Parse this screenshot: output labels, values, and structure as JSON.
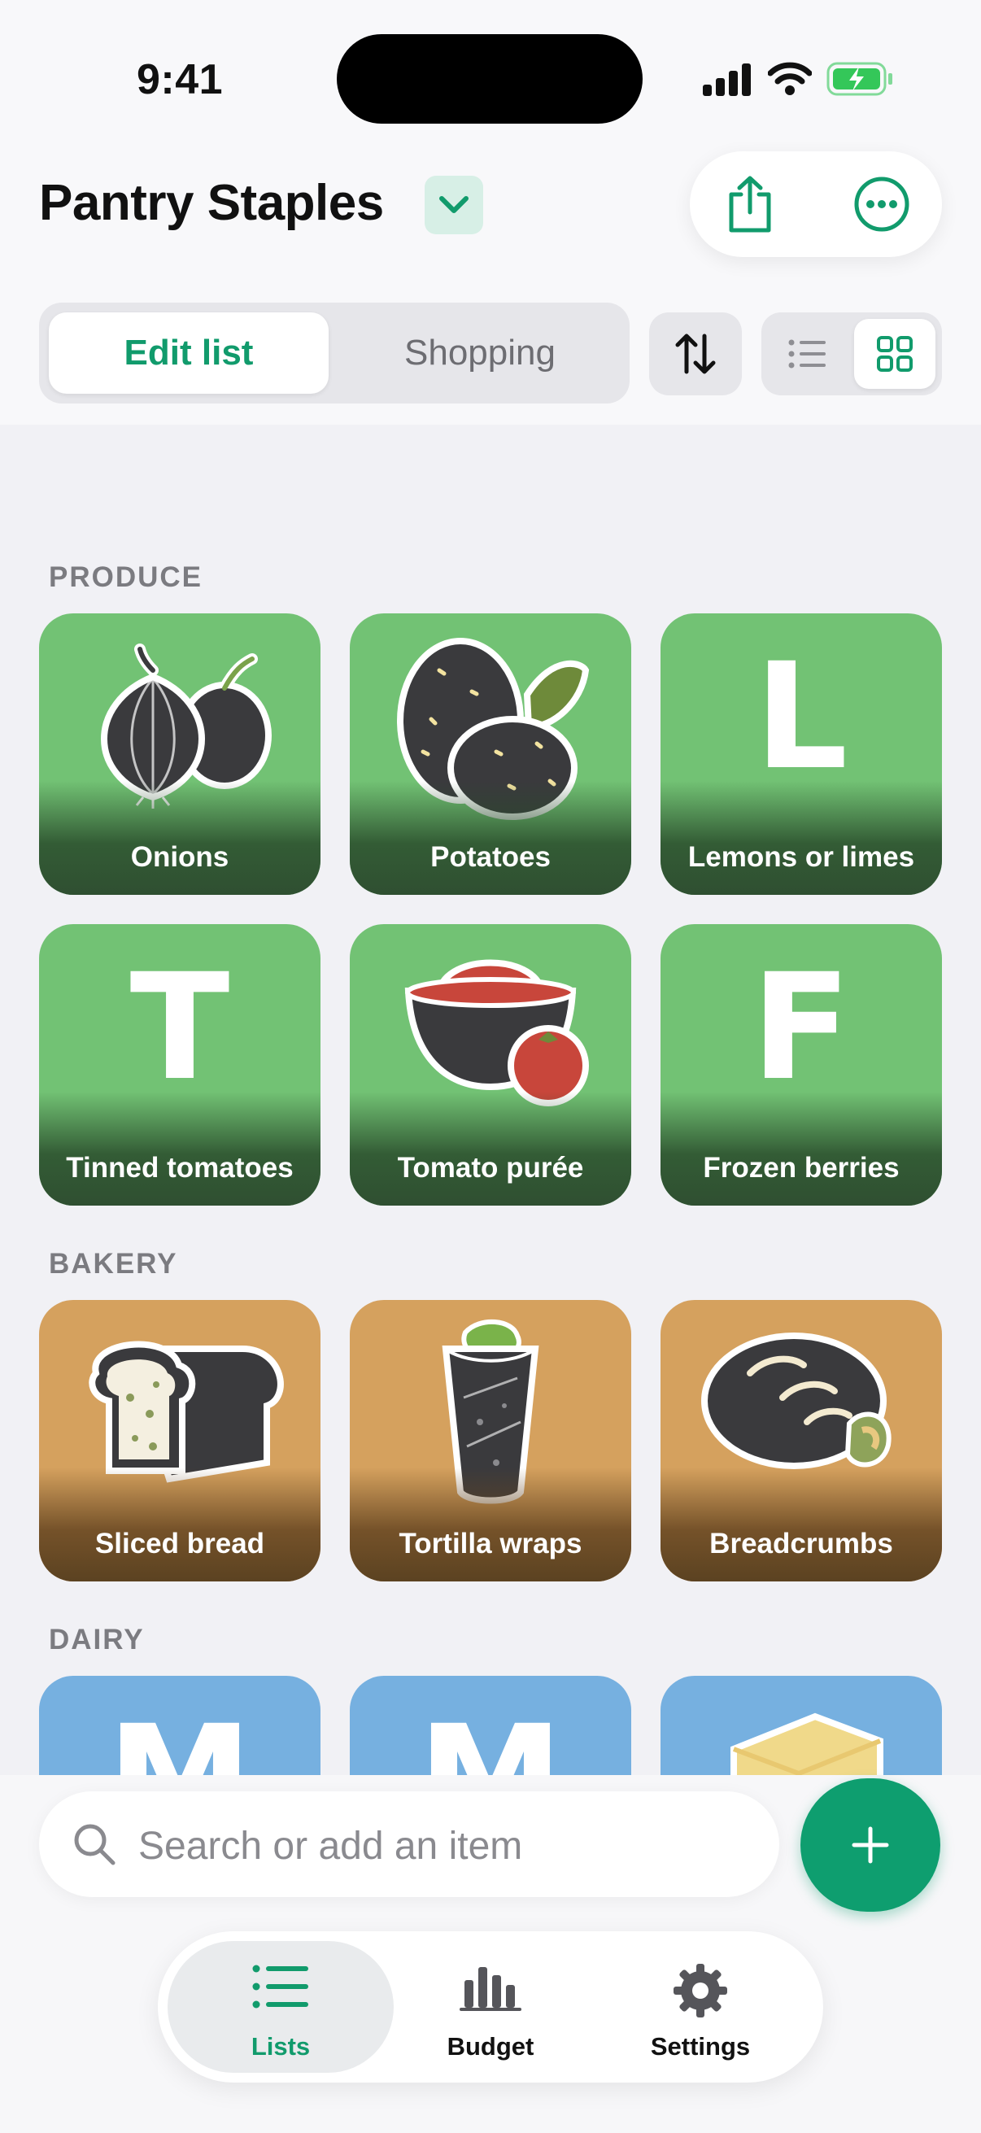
{
  "status_bar": {
    "time": "9:41"
  },
  "header": {
    "title": "Pantry Staples",
    "segments": [
      {
        "label": "Edit list",
        "active": true
      },
      {
        "label": "Shopping",
        "active": false
      }
    ],
    "view_mode": "grid"
  },
  "sections": [
    {
      "label": "PRODUCE",
      "color": "#72c274",
      "items": [
        {
          "label": "Onions",
          "icon": "onion-icon"
        },
        {
          "label": "Potatoes",
          "icon": "potato-icon"
        },
        {
          "label": "Lemons or limes",
          "letter": "L"
        },
        {
          "label": "Tinned tomatoes",
          "letter": "T"
        },
        {
          "label": "Tomato purée",
          "icon": "tomato-puree-icon"
        },
        {
          "label": "Frozen berries",
          "letter": "F"
        }
      ]
    },
    {
      "label": "BAKERY",
      "color": "#d5a15e",
      "items": [
        {
          "label": "Sliced bread",
          "icon": "bread-icon"
        },
        {
          "label": "Tortilla wraps",
          "icon": "wrap-icon"
        },
        {
          "label": "Breadcrumbs",
          "icon": "breadcrumbs-icon"
        }
      ]
    },
    {
      "label": "DAIRY",
      "color": "#76b0e0",
      "items": [
        {
          "letter": "M"
        },
        {
          "letter": "M"
        },
        {
          "icon": "butter-icon"
        }
      ]
    }
  ],
  "search": {
    "placeholder": "Search or add an item"
  },
  "tabs": [
    {
      "label": "Lists",
      "icon": "list-icon",
      "active": true
    },
    {
      "label": "Budget",
      "icon": "bar-chart-icon",
      "active": false
    },
    {
      "label": "Settings",
      "icon": "gear-icon",
      "active": false
    }
  ],
  "colors": {
    "accent": "#0e9e6f",
    "produce": "#72c274",
    "bakery": "#d5a15e",
    "dairy": "#76b0e0"
  }
}
